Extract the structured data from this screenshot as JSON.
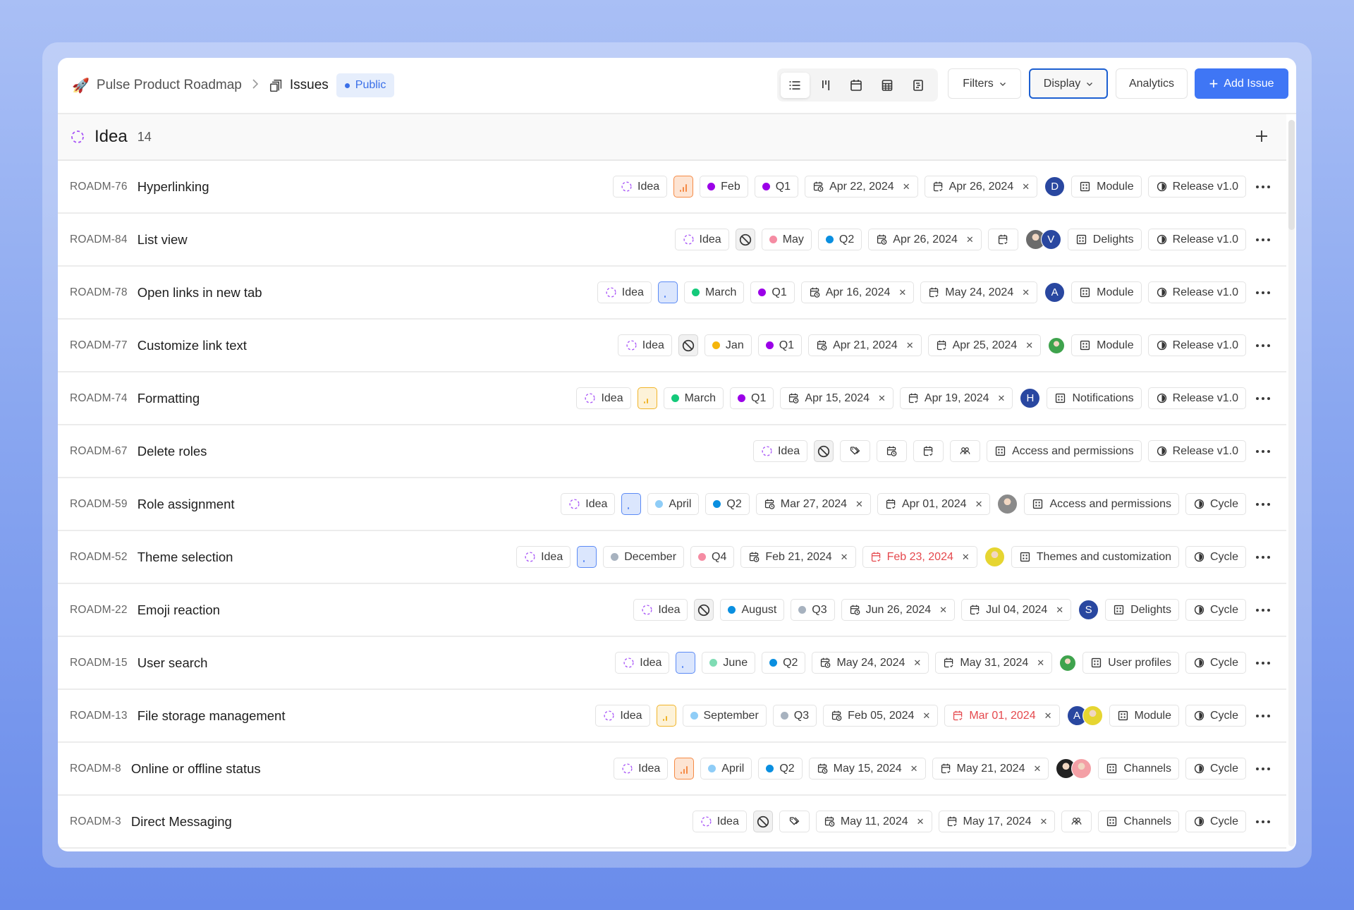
{
  "header": {
    "project_icon": "rocket-emoji",
    "project_name": "Pulse Product Roadmap",
    "separator_icon": "chevron-right-icon",
    "page_icon": "layers-icon",
    "page_title": "Issues",
    "visibility_badge": "Public",
    "layouts": [
      {
        "name": "list",
        "icon": "list-icon",
        "active": true
      },
      {
        "name": "kanban",
        "icon": "kanban-icon",
        "active": false
      },
      {
        "name": "calendar",
        "icon": "calendar-icon",
        "active": false
      },
      {
        "name": "spreadsheet",
        "icon": "table-icon",
        "active": false
      },
      {
        "name": "gantt",
        "icon": "gantt-icon",
        "active": false
      }
    ],
    "filters_label": "Filters",
    "display_label": "Display",
    "analytics_label": "Analytics",
    "add_issue_label": "Add Issue"
  },
  "group": {
    "title": "Idea",
    "count": "14",
    "state_color": "#a855f7"
  },
  "colors": {
    "accent": "#3f76f5",
    "overdue": "#e5484d",
    "priority_high": "#f58a45",
    "priority_medium": "#f0b429",
    "priority_low": "#5b8af5"
  },
  "issues": [
    {
      "id": "ROADM-76",
      "title": "Hyperlinking",
      "state": "Idea",
      "priority": "high",
      "labels": [
        {
          "text": "Feb",
          "color": "#9b00e8"
        },
        {
          "text": "Q1",
          "color": "#9b00e8"
        }
      ],
      "start_date": "Apr 22, 2024",
      "due_date": "Apr 26, 2024",
      "due_overdue": false,
      "assignees": [
        {
          "initial": "D",
          "color": "#2947a0"
        }
      ],
      "module": "Module",
      "cycle": "Release v1.0"
    },
    {
      "id": "ROADM-84",
      "title": "List view",
      "state": "Idea",
      "priority": "none",
      "labels": [
        {
          "text": "May",
          "color": "#f58ca3"
        },
        {
          "text": "Q2",
          "color": "#0a8fe0"
        }
      ],
      "start_date": "Apr 26, 2024",
      "due_date": "",
      "due_overdue": false,
      "assignees": [
        {
          "initial": "",
          "color": "#6b6b6b",
          "photo": true
        },
        {
          "initial": "V",
          "color": "#2947a0"
        }
      ],
      "module": "Delights",
      "cycle": "Release v1.0"
    },
    {
      "id": "ROADM-78",
      "title": "Open links in new tab",
      "state": "Idea",
      "priority": "low",
      "labels": [
        {
          "text": "March",
          "color": "#14c97a"
        },
        {
          "text": "Q1",
          "color": "#9b00e8"
        }
      ],
      "start_date": "Apr 16, 2024",
      "due_date": "May 24, 2024",
      "due_overdue": false,
      "assignees": [
        {
          "initial": "A",
          "color": "#2947a0"
        }
      ],
      "module": "Module",
      "cycle": "Release v1.0"
    },
    {
      "id": "ROADM-77",
      "title": "Customize link text",
      "state": "Idea",
      "priority": "none",
      "labels": [
        {
          "text": "Jan",
          "color": "#f5b50a"
        },
        {
          "text": "Q1",
          "color": "#9b00e8"
        }
      ],
      "start_date": "Apr 21, 2024",
      "due_date": "Apr 25, 2024",
      "due_overdue": false,
      "assignees": [
        {
          "initial": "",
          "color": "#3fa34d",
          "photo": true,
          "small": true
        }
      ],
      "module": "Module",
      "cycle": "Release v1.0"
    },
    {
      "id": "ROADM-74",
      "title": "Formatting",
      "state": "Idea",
      "priority": "medium",
      "labels": [
        {
          "text": "March",
          "color": "#14c97a"
        },
        {
          "text": "Q1",
          "color": "#9b00e8"
        }
      ],
      "start_date": "Apr 15, 2024",
      "due_date": "Apr 19, 2024",
      "due_overdue": false,
      "assignees": [
        {
          "initial": "H",
          "color": "#2947a0"
        }
      ],
      "module": "Notifications",
      "cycle": "Release v1.0"
    },
    {
      "id": "ROADM-67",
      "title": "Delete roles",
      "state": "Idea",
      "priority": "none",
      "labels": [],
      "start_date": "",
      "due_date": "",
      "due_overdue": false,
      "assignees": [],
      "module": "Access and permissions",
      "cycle": "Release v1.0"
    },
    {
      "id": "ROADM-59",
      "title": "Role assignment",
      "state": "Idea",
      "priority": "low",
      "labels": [
        {
          "text": "April",
          "color": "#8fcdf7"
        },
        {
          "text": "Q2",
          "color": "#0a8fe0"
        }
      ],
      "start_date": "Mar 27, 2024",
      "due_date": "Apr 01, 2024",
      "due_overdue": false,
      "assignees": [
        {
          "initial": "",
          "color": "#8a8a8a",
          "photo": true
        }
      ],
      "module": "Access and permissions",
      "cycle": "Cycle"
    },
    {
      "id": "ROADM-52",
      "title": "Theme selection",
      "state": "Idea",
      "priority": "low",
      "labels": [
        {
          "text": "December",
          "color": "#a7b2bf"
        },
        {
          "text": "Q4",
          "color": "#f58ca3"
        }
      ],
      "start_date": "Feb 21, 2024",
      "due_date": "Feb 23, 2024",
      "due_overdue": true,
      "assignees": [
        {
          "initial": "",
          "color": "#e6d531",
          "photo": true
        }
      ],
      "module": "Themes and customization",
      "cycle": "Cycle"
    },
    {
      "id": "ROADM-22",
      "title": "Emoji reaction",
      "state": "Idea",
      "priority": "none",
      "labels": [
        {
          "text": "August",
          "color": "#0a8fe0"
        },
        {
          "text": "Q3",
          "color": "#a7b2bf"
        }
      ],
      "start_date": "Jun 26, 2024",
      "due_date": "Jul 04, 2024",
      "due_overdue": false,
      "assignees": [
        {
          "initial": "S",
          "color": "#2947a0"
        }
      ],
      "module": "Delights",
      "cycle": "Cycle"
    },
    {
      "id": "ROADM-15",
      "title": "User search",
      "state": "Idea",
      "priority": "low",
      "labels": [
        {
          "text": "June",
          "color": "#7fdcb4"
        },
        {
          "text": "Q2",
          "color": "#0a8fe0"
        }
      ],
      "start_date": "May 24, 2024",
      "due_date": "May 31, 2024",
      "due_overdue": false,
      "assignees": [
        {
          "initial": "",
          "color": "#3fa34d",
          "photo": true,
          "small": true
        }
      ],
      "module": "User profiles",
      "cycle": "Cycle"
    },
    {
      "id": "ROADM-13",
      "title": "File storage management",
      "state": "Idea",
      "priority": "medium",
      "labels": [
        {
          "text": "September",
          "color": "#8fcdf7"
        },
        {
          "text": "Q3",
          "color": "#a7b2bf"
        }
      ],
      "start_date": "Feb 05, 2024",
      "due_date": "Mar 01, 2024",
      "due_overdue": true,
      "assignees": [
        {
          "initial": "A",
          "color": "#2947a0"
        },
        {
          "initial": "",
          "color": "#e6d531",
          "photo": true
        }
      ],
      "module": "Module",
      "cycle": "Cycle"
    },
    {
      "id": "ROADM-8",
      "title": "Online or offline status",
      "state": "Idea",
      "priority": "high",
      "labels": [
        {
          "text": "April",
          "color": "#8fcdf7"
        },
        {
          "text": "Q2",
          "color": "#0a8fe0"
        }
      ],
      "start_date": "May 15, 2024",
      "due_date": "May 21, 2024",
      "due_overdue": false,
      "assignees": [
        {
          "initial": "",
          "color": "#222222",
          "photo": true
        },
        {
          "initial": "",
          "color": "#f4a0a6",
          "photo": true
        }
      ],
      "module": "Channels",
      "cycle": "Cycle"
    },
    {
      "id": "ROADM-3",
      "title": "Direct Messaging",
      "state": "Idea",
      "priority": "none",
      "labels": [],
      "start_date": "May 11, 2024",
      "due_date": "May 17, 2024",
      "due_overdue": false,
      "assignees": [],
      "module": "Channels",
      "cycle": "Cycle"
    }
  ]
}
